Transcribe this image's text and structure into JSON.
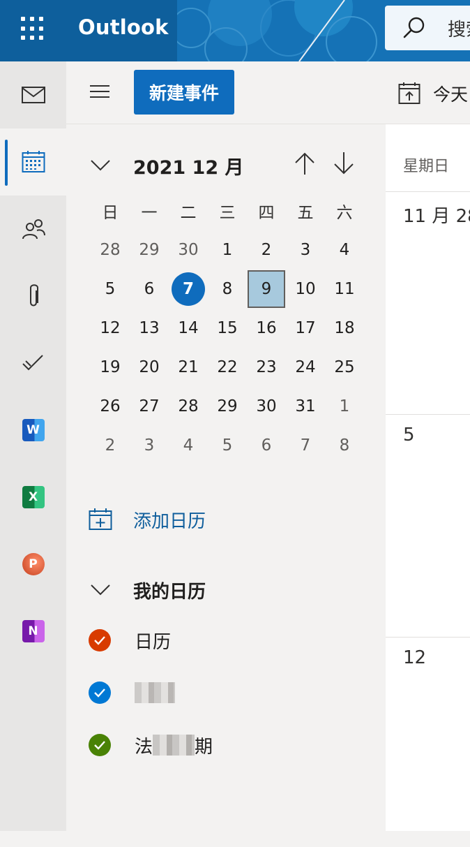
{
  "header": {
    "brand": "Outlook",
    "search_placeholder": "搜索",
    "accent": "#0f6cbd"
  },
  "rail": {
    "items": [
      {
        "name": "mail",
        "icon": "mail-icon"
      },
      {
        "name": "calendar",
        "icon": "calendar-icon",
        "active": true
      },
      {
        "name": "people",
        "icon": "people-icon"
      },
      {
        "name": "files",
        "icon": "paperclip-icon"
      },
      {
        "name": "todo",
        "icon": "todo-check-icon"
      },
      {
        "name": "word",
        "icon": "word-app-icon",
        "letter": "W"
      },
      {
        "name": "excel",
        "icon": "excel-app-icon",
        "letter": "X"
      },
      {
        "name": "powerpoint",
        "icon": "powerpoint-app-icon",
        "letter": "P"
      },
      {
        "name": "onenote",
        "icon": "onenote-app-icon",
        "letter": "N"
      }
    ]
  },
  "nav": {
    "new_event_label": "新建事件",
    "mini_calendar": {
      "month_title": "2021 12 月",
      "weekdays": [
        "日",
        "一",
        "二",
        "三",
        "四",
        "五",
        "六"
      ],
      "weeks": [
        [
          "28",
          "29",
          "30",
          "1",
          "2",
          "3",
          "4"
        ],
        [
          "5",
          "6",
          "7",
          "8",
          "9",
          "10",
          "11"
        ],
        [
          "12",
          "13",
          "14",
          "15",
          "16",
          "17",
          "18"
        ],
        [
          "19",
          "20",
          "21",
          "22",
          "23",
          "24",
          "25"
        ],
        [
          "26",
          "27",
          "28",
          "29",
          "30",
          "31",
          "1"
        ],
        [
          "2",
          "3",
          "4",
          "5",
          "6",
          "7",
          "8"
        ]
      ],
      "today": "7",
      "selected": "9"
    },
    "add_calendar_label": "添加日历",
    "my_calendars_label": "我的日历",
    "calendars": [
      {
        "label": "日历",
        "color": "#d83b01"
      },
      {
        "label": "",
        "color": "#0078d4"
      },
      {
        "label": "法",
        "label_end": "期",
        "color": "#498205"
      }
    ]
  },
  "main": {
    "today_label": "今天",
    "weekday_header": "星期日",
    "weeks": [
      {
        "label": "11 月 28"
      },
      {
        "label": "5"
      },
      {
        "label": "12"
      }
    ]
  }
}
